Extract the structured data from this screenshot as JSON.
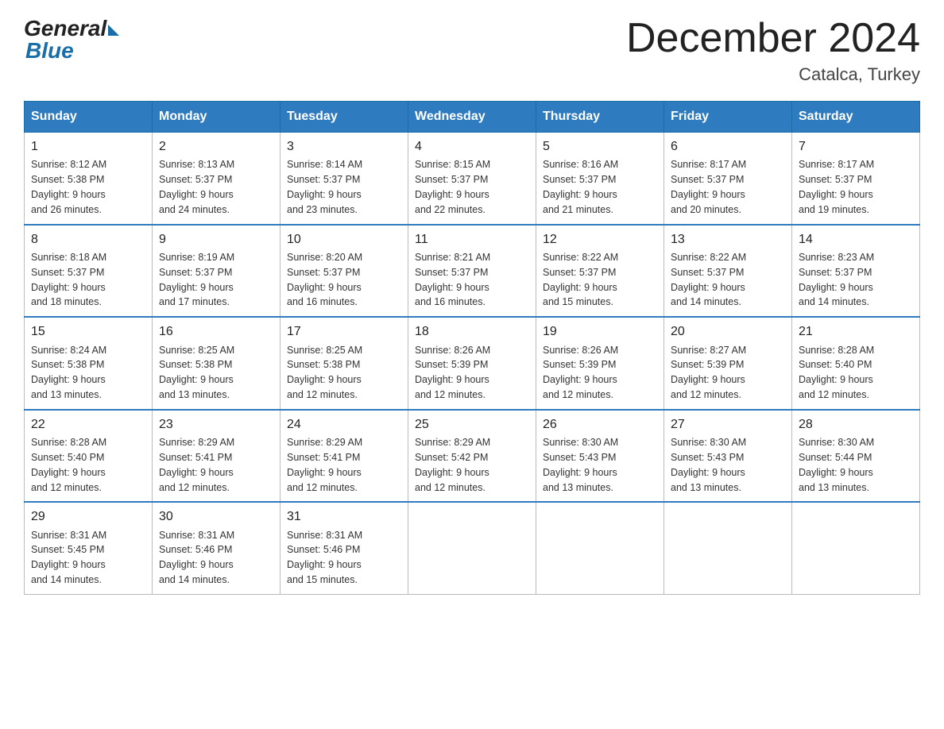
{
  "logo": {
    "general": "General",
    "blue": "Blue"
  },
  "header": {
    "title": "December 2024",
    "location": "Catalca, Turkey"
  },
  "days_of_week": [
    "Sunday",
    "Monday",
    "Tuesday",
    "Wednesday",
    "Thursday",
    "Friday",
    "Saturday"
  ],
  "weeks": [
    [
      {
        "day": "1",
        "sunrise": "8:12 AM",
        "sunset": "5:38 PM",
        "daylight": "9 hours and 26 minutes."
      },
      {
        "day": "2",
        "sunrise": "8:13 AM",
        "sunset": "5:37 PM",
        "daylight": "9 hours and 24 minutes."
      },
      {
        "day": "3",
        "sunrise": "8:14 AM",
        "sunset": "5:37 PM",
        "daylight": "9 hours and 23 minutes."
      },
      {
        "day": "4",
        "sunrise": "8:15 AM",
        "sunset": "5:37 PM",
        "daylight": "9 hours and 22 minutes."
      },
      {
        "day": "5",
        "sunrise": "8:16 AM",
        "sunset": "5:37 PM",
        "daylight": "9 hours and 21 minutes."
      },
      {
        "day": "6",
        "sunrise": "8:17 AM",
        "sunset": "5:37 PM",
        "daylight": "9 hours and 20 minutes."
      },
      {
        "day": "7",
        "sunrise": "8:17 AM",
        "sunset": "5:37 PM",
        "daylight": "9 hours and 19 minutes."
      }
    ],
    [
      {
        "day": "8",
        "sunrise": "8:18 AM",
        "sunset": "5:37 PM",
        "daylight": "9 hours and 18 minutes."
      },
      {
        "day": "9",
        "sunrise": "8:19 AM",
        "sunset": "5:37 PM",
        "daylight": "9 hours and 17 minutes."
      },
      {
        "day": "10",
        "sunrise": "8:20 AM",
        "sunset": "5:37 PM",
        "daylight": "9 hours and 16 minutes."
      },
      {
        "day": "11",
        "sunrise": "8:21 AM",
        "sunset": "5:37 PM",
        "daylight": "9 hours and 16 minutes."
      },
      {
        "day": "12",
        "sunrise": "8:22 AM",
        "sunset": "5:37 PM",
        "daylight": "9 hours and 15 minutes."
      },
      {
        "day": "13",
        "sunrise": "8:22 AM",
        "sunset": "5:37 PM",
        "daylight": "9 hours and 14 minutes."
      },
      {
        "day": "14",
        "sunrise": "8:23 AM",
        "sunset": "5:37 PM",
        "daylight": "9 hours and 14 minutes."
      }
    ],
    [
      {
        "day": "15",
        "sunrise": "8:24 AM",
        "sunset": "5:38 PM",
        "daylight": "9 hours and 13 minutes."
      },
      {
        "day": "16",
        "sunrise": "8:25 AM",
        "sunset": "5:38 PM",
        "daylight": "9 hours and 13 minutes."
      },
      {
        "day": "17",
        "sunrise": "8:25 AM",
        "sunset": "5:38 PM",
        "daylight": "9 hours and 12 minutes."
      },
      {
        "day": "18",
        "sunrise": "8:26 AM",
        "sunset": "5:39 PM",
        "daylight": "9 hours and 12 minutes."
      },
      {
        "day": "19",
        "sunrise": "8:26 AM",
        "sunset": "5:39 PM",
        "daylight": "9 hours and 12 minutes."
      },
      {
        "day": "20",
        "sunrise": "8:27 AM",
        "sunset": "5:39 PM",
        "daylight": "9 hours and 12 minutes."
      },
      {
        "day": "21",
        "sunrise": "8:28 AM",
        "sunset": "5:40 PM",
        "daylight": "9 hours and 12 minutes."
      }
    ],
    [
      {
        "day": "22",
        "sunrise": "8:28 AM",
        "sunset": "5:40 PM",
        "daylight": "9 hours and 12 minutes."
      },
      {
        "day": "23",
        "sunrise": "8:29 AM",
        "sunset": "5:41 PM",
        "daylight": "9 hours and 12 minutes."
      },
      {
        "day": "24",
        "sunrise": "8:29 AM",
        "sunset": "5:41 PM",
        "daylight": "9 hours and 12 minutes."
      },
      {
        "day": "25",
        "sunrise": "8:29 AM",
        "sunset": "5:42 PM",
        "daylight": "9 hours and 12 minutes."
      },
      {
        "day": "26",
        "sunrise": "8:30 AM",
        "sunset": "5:43 PM",
        "daylight": "9 hours and 13 minutes."
      },
      {
        "day": "27",
        "sunrise": "8:30 AM",
        "sunset": "5:43 PM",
        "daylight": "9 hours and 13 minutes."
      },
      {
        "day": "28",
        "sunrise": "8:30 AM",
        "sunset": "5:44 PM",
        "daylight": "9 hours and 13 minutes."
      }
    ],
    [
      {
        "day": "29",
        "sunrise": "8:31 AM",
        "sunset": "5:45 PM",
        "daylight": "9 hours and 14 minutes."
      },
      {
        "day": "30",
        "sunrise": "8:31 AM",
        "sunset": "5:46 PM",
        "daylight": "9 hours and 14 minutes."
      },
      {
        "day": "31",
        "sunrise": "8:31 AM",
        "sunset": "5:46 PM",
        "daylight": "9 hours and 15 minutes."
      },
      null,
      null,
      null,
      null
    ]
  ],
  "labels": {
    "sunrise": "Sunrise:",
    "sunset": "Sunset:",
    "daylight": "Daylight:"
  }
}
